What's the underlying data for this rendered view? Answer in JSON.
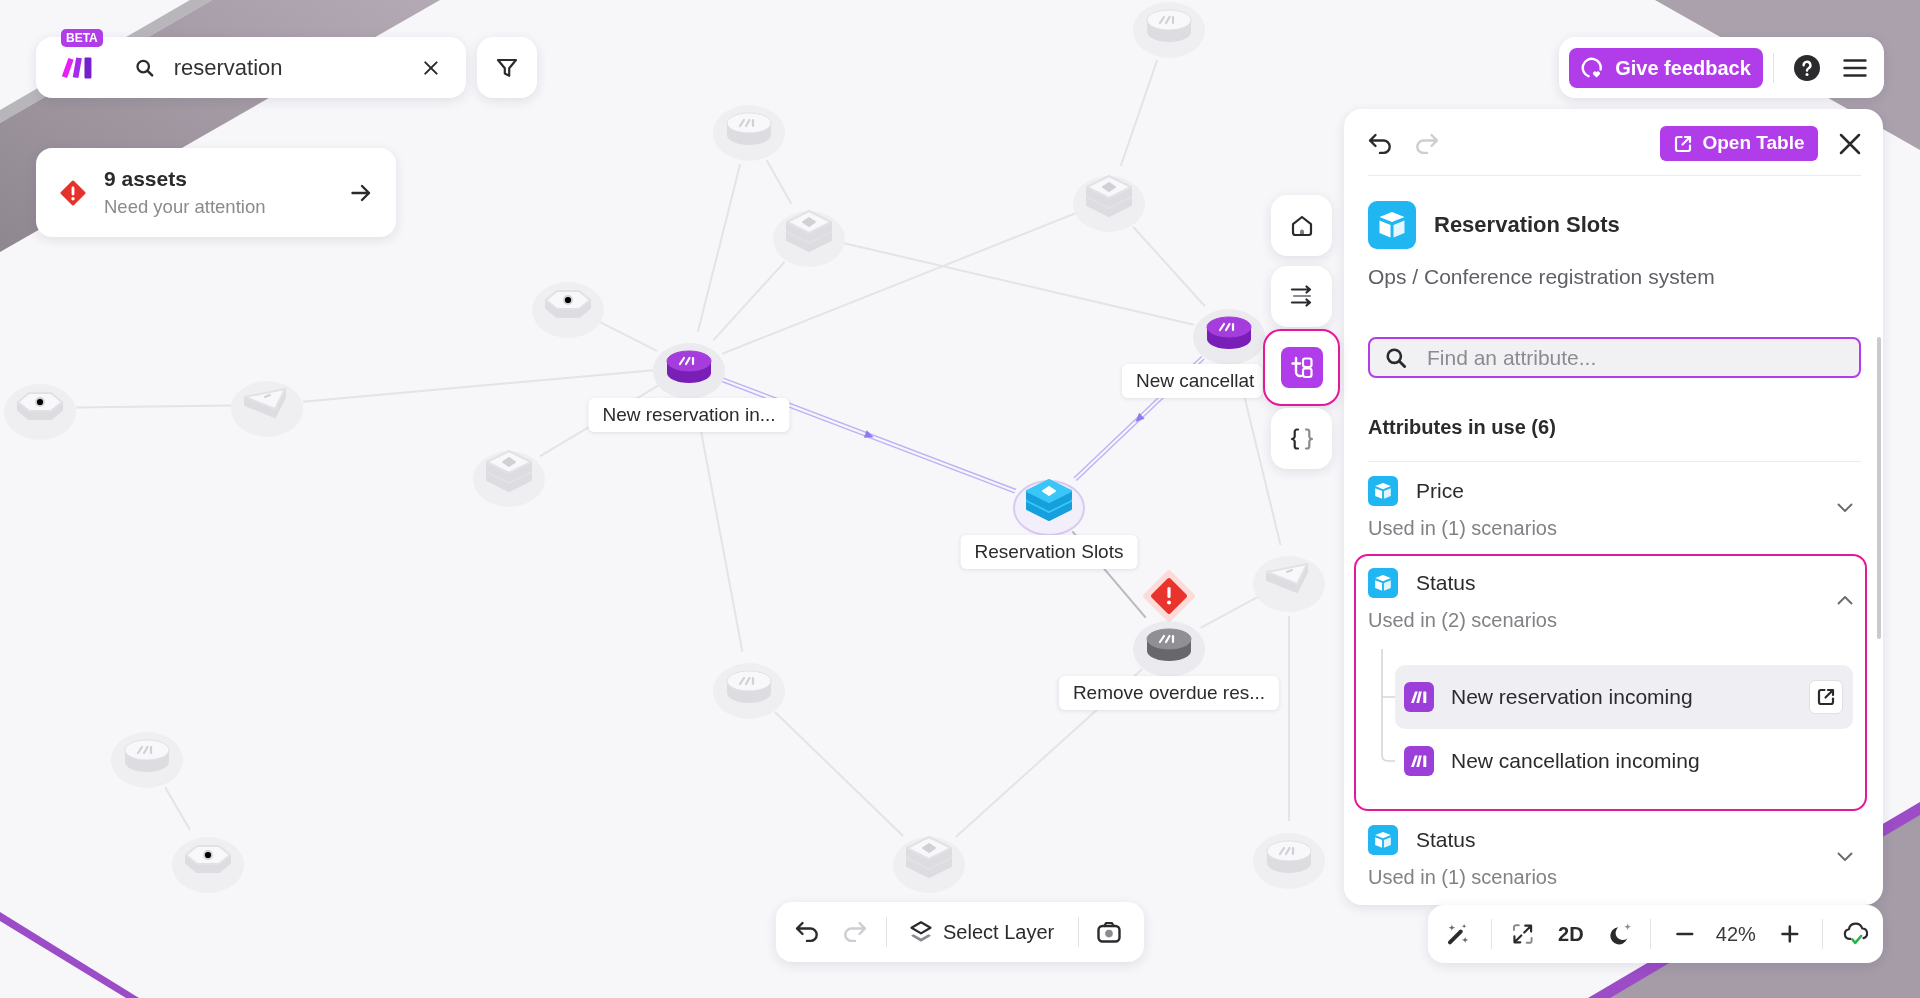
{
  "search_bar": {
    "badge": "BETA",
    "query": "reservation"
  },
  "alert_card": {
    "title": "9 assets",
    "subtitle": "Need your attention"
  },
  "top_toolbar": {
    "feedback_button": "Give feedback"
  },
  "graph": {
    "nodes": [
      {
        "kind": "cylinder",
        "label": "New reservation in...",
        "dimmed": false,
        "disabled": false,
        "selected": false,
        "warning": false
      },
      {
        "kind": "cylinder",
        "label": "New cancellat",
        "dimmed": false,
        "disabled": false,
        "selected": false,
        "warning": false
      },
      {
        "kind": "stack",
        "label": "Reservation Slots",
        "dimmed": false,
        "disabled": false,
        "selected": true,
        "warning": false
      },
      {
        "kind": "cylinder",
        "label": "Remove overdue res...",
        "dimmed": false,
        "disabled": true,
        "selected": false,
        "warning": true
      },
      {
        "kind": "cylinder",
        "dimmed": true,
        "disabled": false,
        "selected": false,
        "warning": false
      },
      {
        "kind": "cylinder",
        "dimmed": true,
        "disabled": false,
        "selected": false,
        "warning": false
      },
      {
        "kind": "stack",
        "dimmed": true,
        "disabled": false,
        "selected": false,
        "warning": false
      },
      {
        "kind": "stack",
        "dimmed": true,
        "disabled": false,
        "selected": false,
        "warning": false
      },
      {
        "kind": "hexagon",
        "dimmed": true,
        "disabled": false,
        "selected": false,
        "warning": false
      },
      {
        "kind": "hexagon",
        "dimmed": true,
        "disabled": false,
        "selected": false,
        "warning": false
      },
      {
        "kind": "prism",
        "dimmed": true,
        "disabled": false,
        "selected": false,
        "warning": false
      },
      {
        "kind": "stack",
        "dimmed": true,
        "disabled": false,
        "selected": false,
        "warning": false
      },
      {
        "kind": "prism",
        "dimmed": true,
        "disabled": false,
        "selected": false,
        "warning": false
      },
      {
        "kind": "cylinder",
        "dimmed": true,
        "disabled": false,
        "selected": false,
        "warning": false
      },
      {
        "kind": "cylinder",
        "dimmed": true,
        "disabled": false,
        "selected": false,
        "warning": false
      },
      {
        "kind": "hexagon",
        "dimmed": true,
        "disabled": false,
        "selected": false,
        "warning": false
      },
      {
        "kind": "stack",
        "dimmed": true,
        "disabled": false,
        "selected": false,
        "warning": false
      },
      {
        "kind": "cylinder",
        "dimmed": true,
        "disabled": false,
        "selected": false,
        "warning": false
      }
    ]
  },
  "side_toolbar": [
    {
      "kind": "home",
      "selected": false
    },
    {
      "kind": "flows",
      "selected": false
    },
    {
      "kind": "structure",
      "selected": true
    },
    {
      "kind": "code",
      "selected": false
    }
  ],
  "panel": {
    "history": [
      {
        "kind": "undo",
        "disabled": false
      },
      {
        "kind": "redo",
        "disabled": true
      }
    ],
    "open_button": "Open Table",
    "title": "Reservation Slots",
    "path": "Ops / Conference registration system",
    "search": {
      "placeholder": "Find an attribute..."
    },
    "section_title": "Attributes in use (6)",
    "attributes": [
      {
        "name": "Price",
        "usage": "Used in (1) scenarios",
        "expanded": false
      },
      {
        "name": "Status",
        "usage": "Used in (2) scenarios",
        "expanded": true,
        "scenarios": [
          {
            "name": "New reservation incoming",
            "selected": true
          },
          {
            "name": "New cancellation incoming",
            "selected": false
          }
        ]
      },
      {
        "name": "Status",
        "usage": "Used in (1) scenarios",
        "expanded": false
      }
    ]
  },
  "layer_toolbar": {
    "history": [
      {
        "kind": "undo",
        "disabled": false
      },
      {
        "kind": "redo",
        "disabled": true
      }
    ],
    "label": "Select Layer"
  },
  "view_toolbar": {
    "mode": "2D",
    "zoom": "42%",
    "saved": true
  }
}
